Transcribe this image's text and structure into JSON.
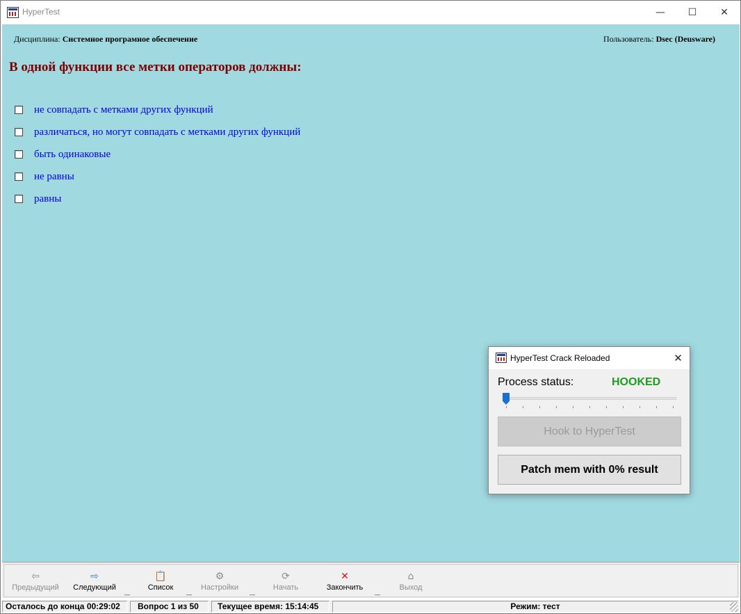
{
  "window": {
    "title": "HyperTest",
    "controls": {
      "minimize": "—",
      "maximize": "☐",
      "close": "✕"
    }
  },
  "header": {
    "discipline_label": "Дисциплина:",
    "discipline_value": "Системное програмное обеспечение",
    "user_label": "Пользователь:",
    "user_value": "Dsec (Deusware)"
  },
  "question": {
    "text": "В одной функции все метки операторов должны:",
    "answers": [
      {
        "text": "не совпадать с метками других функций",
        "checked": false
      },
      {
        "text": "различаться, но могут совпадать с метками других функций",
        "checked": false
      },
      {
        "text": "быть одинаковые",
        "checked": false
      },
      {
        "text": "не равны",
        "checked": false
      },
      {
        "text": "равны",
        "checked": false
      }
    ]
  },
  "dialog": {
    "title": "HyperTest Crack Reloaded",
    "close": "✕",
    "status_label": "Process status:",
    "status_value": "HOOKED",
    "status_color": "#1e9a1e",
    "slider_value": 0,
    "slider_ticks": 11,
    "hook_button": "Hook to HyperTest",
    "hook_enabled": false,
    "patch_button": "Patch mem with 0% result"
  },
  "toolbar": {
    "items": [
      {
        "label": "Предыдущий",
        "icon": "arrow-left-icon",
        "glyph": "⇦",
        "enabled": false
      },
      {
        "label": "Следующий",
        "icon": "arrow-right-icon",
        "glyph": "⇨",
        "enabled": true,
        "color": "#2a7de0"
      },
      {
        "label": "Список",
        "icon": "list-icon",
        "glyph": "📋",
        "enabled": true
      },
      {
        "label": "Настройки",
        "icon": "settings-icon",
        "glyph": "⚙",
        "enabled": false
      },
      {
        "label": "Начать",
        "icon": "start-icon",
        "glyph": "⟳",
        "enabled": false
      },
      {
        "label": "Закончить",
        "icon": "stop-icon",
        "glyph": "✕",
        "enabled": true,
        "color": "#e01010"
      },
      {
        "label": "Выход",
        "icon": "home-icon",
        "glyph": "⌂",
        "enabled": false
      }
    ]
  },
  "statusbar": {
    "time_left": "Осталось до конца 00:29:02",
    "question_counter": "Вопрос 1 из 50",
    "current_time": "Текущее время: 15:14:45",
    "mode": "Режим: тест"
  }
}
